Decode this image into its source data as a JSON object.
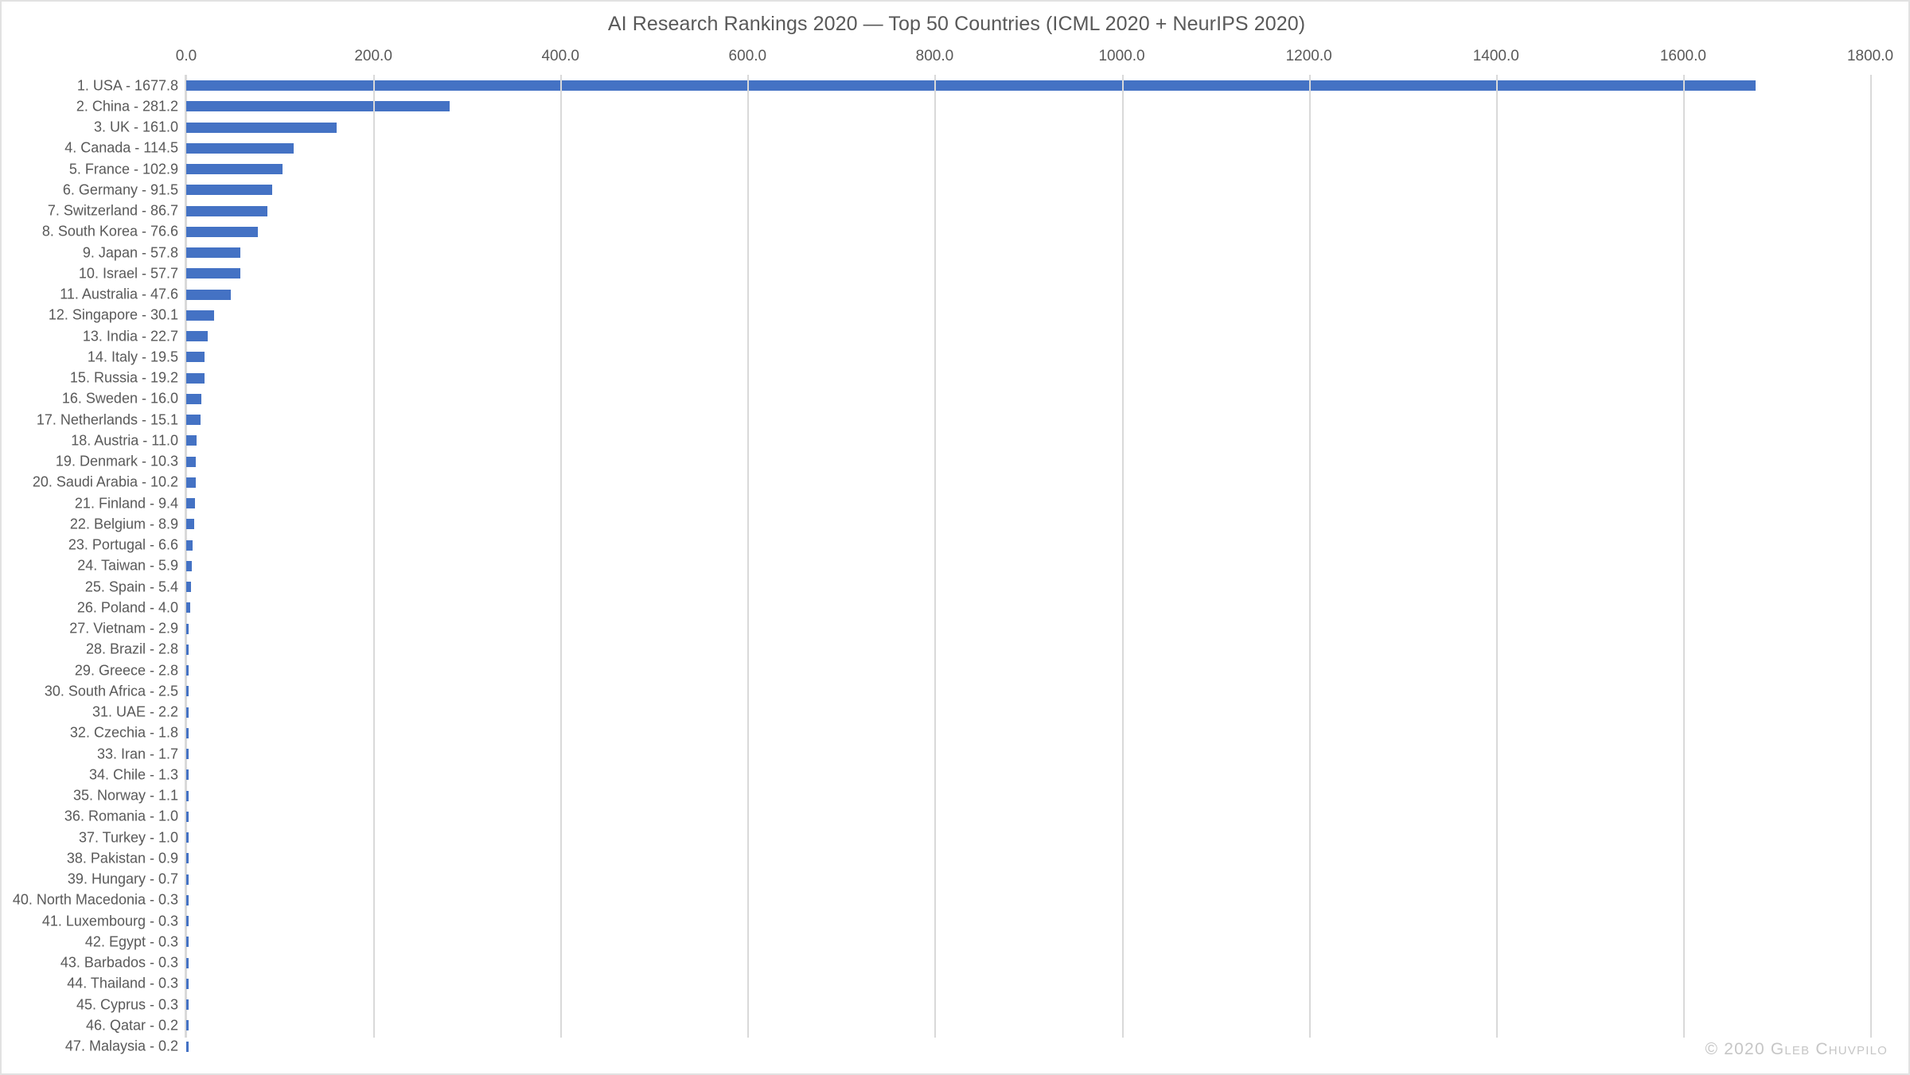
{
  "chart_data": {
    "type": "bar",
    "orientation": "horizontal",
    "title": "AI Research Rankings 2020 — Top 50 Countries (ICML 2020 + NeurIPS 2020)",
    "xlabel": "",
    "ylabel": "",
    "xlim": [
      0,
      1800
    ],
    "xticks": [
      0,
      200,
      400,
      600,
      800,
      1000,
      1200,
      1400,
      1600,
      1800
    ],
    "xtick_labels": [
      "0.0",
      "200.0",
      "400.0",
      "600.0",
      "800.0",
      "1000.0",
      "1200.0",
      "1400.0",
      "1600.0",
      "1800.0"
    ],
    "grid": true,
    "grid_axis": "x",
    "legend": false,
    "bar_color": "#4472C4",
    "categories": [
      "1. USA - 1677.8",
      "2. China - 281.2",
      "3. UK - 161.0",
      "4. Canada - 114.5",
      "5. France - 102.9",
      "6. Germany - 91.5",
      "7. Switzerland - 86.7",
      "8. South Korea - 76.6",
      "9. Japan - 57.8",
      "10. Israel - 57.7",
      "11. Australia - 47.6",
      "12. Singapore - 30.1",
      "13. India - 22.7",
      "14. Italy - 19.5",
      "15. Russia - 19.2",
      "16. Sweden - 16.0",
      "17. Netherlands - 15.1",
      "18. Austria - 11.0",
      "19. Denmark - 10.3",
      "20. Saudi Arabia - 10.2",
      "21. Finland - 9.4",
      "22. Belgium - 8.9",
      "23. Portugal - 6.6",
      "24. Taiwan - 5.9",
      "25. Spain - 5.4",
      "26. Poland - 4.0",
      "27. Vietnam - 2.9",
      "28. Brazil - 2.8",
      "29. Greece - 2.8",
      "30. South Africa - 2.5",
      "31. UAE - 2.2",
      "32. Czechia - 1.8",
      "33. Iran - 1.7",
      "34. Chile - 1.3",
      "35. Norway - 1.1",
      "36. Romania - 1.0",
      "37. Turkey - 1.0",
      "38. Pakistan - 0.9",
      "39. Hungary - 0.7",
      "40. North Macedonia - 0.3",
      "41. Luxembourg - 0.3",
      "42. Egypt - 0.3",
      "43. Barbados - 0.3",
      "44. Thailand - 0.3",
      "45. Cyprus - 0.3",
      "46. Qatar - 0.2",
      "47. Malaysia - 0.2"
    ],
    "values": [
      1677.8,
      281.2,
      161.0,
      114.5,
      102.9,
      91.5,
      86.7,
      76.6,
      57.8,
      57.7,
      47.6,
      30.1,
      22.7,
      19.5,
      19.2,
      16.0,
      15.1,
      11.0,
      10.3,
      10.2,
      9.4,
      8.9,
      6.6,
      5.9,
      5.4,
      4.0,
      2.9,
      2.8,
      2.8,
      2.5,
      2.2,
      1.8,
      1.7,
      1.3,
      1.1,
      1.0,
      1.0,
      0.9,
      0.7,
      0.3,
      0.3,
      0.3,
      0.3,
      0.3,
      0.3,
      0.2,
      0.2
    ],
    "country_names": [
      "USA",
      "China",
      "UK",
      "Canada",
      "France",
      "Germany",
      "Switzerland",
      "South Korea",
      "Japan",
      "Israel",
      "Australia",
      "Singapore",
      "India",
      "Italy",
      "Russia",
      "Sweden",
      "Netherlands",
      "Austria",
      "Denmark",
      "Saudi Arabia",
      "Finland",
      "Belgium",
      "Portugal",
      "Taiwan",
      "Spain",
      "Poland",
      "Vietnam",
      "Brazil",
      "Greece",
      "South Africa",
      "UAE",
      "Czechia",
      "Iran",
      "Chile",
      "Norway",
      "Romania",
      "Turkey",
      "Pakistan",
      "Hungary",
      "North Macedonia",
      "Luxembourg",
      "Egypt",
      "Barbados",
      "Thailand",
      "Cyprus",
      "Qatar",
      "Malaysia"
    ]
  },
  "watermark": {
    "text": "© 2020 Gleb Chuvpilo"
  }
}
